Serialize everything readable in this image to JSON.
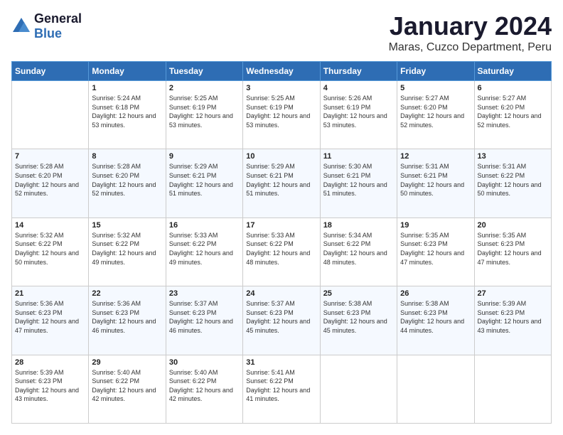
{
  "logo": {
    "general": "General",
    "blue": "Blue"
  },
  "title": "January 2024",
  "subtitle": "Maras, Cuzco Department, Peru",
  "days_of_week": [
    "Sunday",
    "Monday",
    "Tuesday",
    "Wednesday",
    "Thursday",
    "Friday",
    "Saturday"
  ],
  "weeks": [
    [
      {
        "num": "",
        "sunrise": "",
        "sunset": "",
        "daylight": ""
      },
      {
        "num": "1",
        "sunrise": "Sunrise: 5:24 AM",
        "sunset": "Sunset: 6:18 PM",
        "daylight": "Daylight: 12 hours and 53 minutes."
      },
      {
        "num": "2",
        "sunrise": "Sunrise: 5:25 AM",
        "sunset": "Sunset: 6:19 PM",
        "daylight": "Daylight: 12 hours and 53 minutes."
      },
      {
        "num": "3",
        "sunrise": "Sunrise: 5:25 AM",
        "sunset": "Sunset: 6:19 PM",
        "daylight": "Daylight: 12 hours and 53 minutes."
      },
      {
        "num": "4",
        "sunrise": "Sunrise: 5:26 AM",
        "sunset": "Sunset: 6:19 PM",
        "daylight": "Daylight: 12 hours and 53 minutes."
      },
      {
        "num": "5",
        "sunrise": "Sunrise: 5:27 AM",
        "sunset": "Sunset: 6:20 PM",
        "daylight": "Daylight: 12 hours and 52 minutes."
      },
      {
        "num": "6",
        "sunrise": "Sunrise: 5:27 AM",
        "sunset": "Sunset: 6:20 PM",
        "daylight": "Daylight: 12 hours and 52 minutes."
      }
    ],
    [
      {
        "num": "7",
        "sunrise": "Sunrise: 5:28 AM",
        "sunset": "Sunset: 6:20 PM",
        "daylight": "Daylight: 12 hours and 52 minutes."
      },
      {
        "num": "8",
        "sunrise": "Sunrise: 5:28 AM",
        "sunset": "Sunset: 6:20 PM",
        "daylight": "Daylight: 12 hours and 52 minutes."
      },
      {
        "num": "9",
        "sunrise": "Sunrise: 5:29 AM",
        "sunset": "Sunset: 6:21 PM",
        "daylight": "Daylight: 12 hours and 51 minutes."
      },
      {
        "num": "10",
        "sunrise": "Sunrise: 5:29 AM",
        "sunset": "Sunset: 6:21 PM",
        "daylight": "Daylight: 12 hours and 51 minutes."
      },
      {
        "num": "11",
        "sunrise": "Sunrise: 5:30 AM",
        "sunset": "Sunset: 6:21 PM",
        "daylight": "Daylight: 12 hours and 51 minutes."
      },
      {
        "num": "12",
        "sunrise": "Sunrise: 5:31 AM",
        "sunset": "Sunset: 6:21 PM",
        "daylight": "Daylight: 12 hours and 50 minutes."
      },
      {
        "num": "13",
        "sunrise": "Sunrise: 5:31 AM",
        "sunset": "Sunset: 6:22 PM",
        "daylight": "Daylight: 12 hours and 50 minutes."
      }
    ],
    [
      {
        "num": "14",
        "sunrise": "Sunrise: 5:32 AM",
        "sunset": "Sunset: 6:22 PM",
        "daylight": "Daylight: 12 hours and 50 minutes."
      },
      {
        "num": "15",
        "sunrise": "Sunrise: 5:32 AM",
        "sunset": "Sunset: 6:22 PM",
        "daylight": "Daylight: 12 hours and 49 minutes."
      },
      {
        "num": "16",
        "sunrise": "Sunrise: 5:33 AM",
        "sunset": "Sunset: 6:22 PM",
        "daylight": "Daylight: 12 hours and 49 minutes."
      },
      {
        "num": "17",
        "sunrise": "Sunrise: 5:33 AM",
        "sunset": "Sunset: 6:22 PM",
        "daylight": "Daylight: 12 hours and 48 minutes."
      },
      {
        "num": "18",
        "sunrise": "Sunrise: 5:34 AM",
        "sunset": "Sunset: 6:22 PM",
        "daylight": "Daylight: 12 hours and 48 minutes."
      },
      {
        "num": "19",
        "sunrise": "Sunrise: 5:35 AM",
        "sunset": "Sunset: 6:23 PM",
        "daylight": "Daylight: 12 hours and 47 minutes."
      },
      {
        "num": "20",
        "sunrise": "Sunrise: 5:35 AM",
        "sunset": "Sunset: 6:23 PM",
        "daylight": "Daylight: 12 hours and 47 minutes."
      }
    ],
    [
      {
        "num": "21",
        "sunrise": "Sunrise: 5:36 AM",
        "sunset": "Sunset: 6:23 PM",
        "daylight": "Daylight: 12 hours and 47 minutes."
      },
      {
        "num": "22",
        "sunrise": "Sunrise: 5:36 AM",
        "sunset": "Sunset: 6:23 PM",
        "daylight": "Daylight: 12 hours and 46 minutes."
      },
      {
        "num": "23",
        "sunrise": "Sunrise: 5:37 AM",
        "sunset": "Sunset: 6:23 PM",
        "daylight": "Daylight: 12 hours and 46 minutes."
      },
      {
        "num": "24",
        "sunrise": "Sunrise: 5:37 AM",
        "sunset": "Sunset: 6:23 PM",
        "daylight": "Daylight: 12 hours and 45 minutes."
      },
      {
        "num": "25",
        "sunrise": "Sunrise: 5:38 AM",
        "sunset": "Sunset: 6:23 PM",
        "daylight": "Daylight: 12 hours and 45 minutes."
      },
      {
        "num": "26",
        "sunrise": "Sunrise: 5:38 AM",
        "sunset": "Sunset: 6:23 PM",
        "daylight": "Daylight: 12 hours and 44 minutes."
      },
      {
        "num": "27",
        "sunrise": "Sunrise: 5:39 AM",
        "sunset": "Sunset: 6:23 PM",
        "daylight": "Daylight: 12 hours and 43 minutes."
      }
    ],
    [
      {
        "num": "28",
        "sunrise": "Sunrise: 5:39 AM",
        "sunset": "Sunset: 6:23 PM",
        "daylight": "Daylight: 12 hours and 43 minutes."
      },
      {
        "num": "29",
        "sunrise": "Sunrise: 5:40 AM",
        "sunset": "Sunset: 6:22 PM",
        "daylight": "Daylight: 12 hours and 42 minutes."
      },
      {
        "num": "30",
        "sunrise": "Sunrise: 5:40 AM",
        "sunset": "Sunset: 6:22 PM",
        "daylight": "Daylight: 12 hours and 42 minutes."
      },
      {
        "num": "31",
        "sunrise": "Sunrise: 5:41 AM",
        "sunset": "Sunset: 6:22 PM",
        "daylight": "Daylight: 12 hours and 41 minutes."
      },
      {
        "num": "",
        "sunrise": "",
        "sunset": "",
        "daylight": ""
      },
      {
        "num": "",
        "sunrise": "",
        "sunset": "",
        "daylight": ""
      },
      {
        "num": "",
        "sunrise": "",
        "sunset": "",
        "daylight": ""
      }
    ]
  ]
}
